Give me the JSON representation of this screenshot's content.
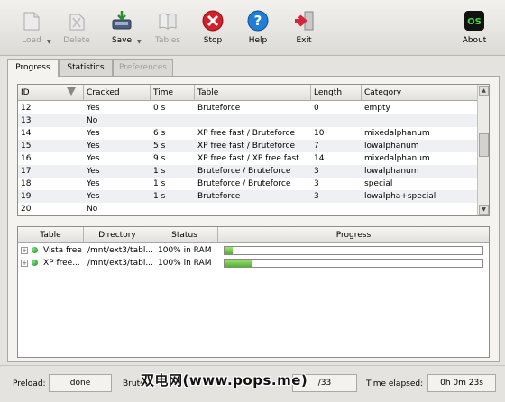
{
  "toolbar": {
    "load": "Load",
    "delete": "Delete",
    "save": "Save",
    "tables": "Tables",
    "stop": "Stop",
    "help": "Help",
    "exit": "Exit",
    "about": "About",
    "logo_text": "OS"
  },
  "tabs": [
    "Progress",
    "Statistics",
    "Preferences"
  ],
  "results": {
    "columns": [
      "ID",
      "Cracked",
      "Time",
      "Table",
      "Length",
      "Category"
    ],
    "rows": [
      [
        "12",
        "Yes",
        "0 s",
        "Bruteforce",
        "0",
        "empty"
      ],
      [
        "13",
        "No",
        "",
        "",
        "",
        ""
      ],
      [
        "14",
        "Yes",
        "6 s",
        "XP free fast / Bruteforce",
        "10",
        "mixedalphanum"
      ],
      [
        "15",
        "Yes",
        "5 s",
        "XP free fast / Bruteforce",
        "7",
        "lowalphanum"
      ],
      [
        "16",
        "Yes",
        "9 s",
        "XP free fast / XP free fast",
        "14",
        "mixedalphanum"
      ],
      [
        "17",
        "Yes",
        "1 s",
        "Bruteforce / Bruteforce",
        "3",
        "lowalphanum"
      ],
      [
        "18",
        "Yes",
        "1 s",
        "Bruteforce / Bruteforce",
        "3",
        "special"
      ],
      [
        "19",
        "Yes",
        "1 s",
        "Bruteforce",
        "3",
        "lowalpha+special"
      ],
      [
        "20",
        "No",
        "",
        "",
        "",
        ""
      ]
    ]
  },
  "tables_panel": {
    "columns": [
      "Table",
      "Directory",
      "Status",
      "Progress"
    ],
    "rows": [
      {
        "table": "Vista free",
        "directory": "/mnt/ext3/tabl...",
        "status": "100% in RAM",
        "progress": 0.03
      },
      {
        "table": "XP free...",
        "directory": "/mnt/ext3/tabl...",
        "status": "100% in RAM",
        "progress": 0.11
      }
    ]
  },
  "statusbar": {
    "preload_label": "Preload:",
    "preload_value": "done",
    "brute_label": "Brute",
    "found_value": "/33",
    "elapsed_label": "Time elapsed:",
    "elapsed_value": "0h 0m 23s"
  },
  "watermark": "双电网(www.pops.me)",
  "colors": {
    "stop": "#d4202a",
    "help": "#1f7fd6",
    "exit": "#d8243a",
    "progress_fill": "#5cc03a",
    "status_dot": "#1f9a1f"
  }
}
